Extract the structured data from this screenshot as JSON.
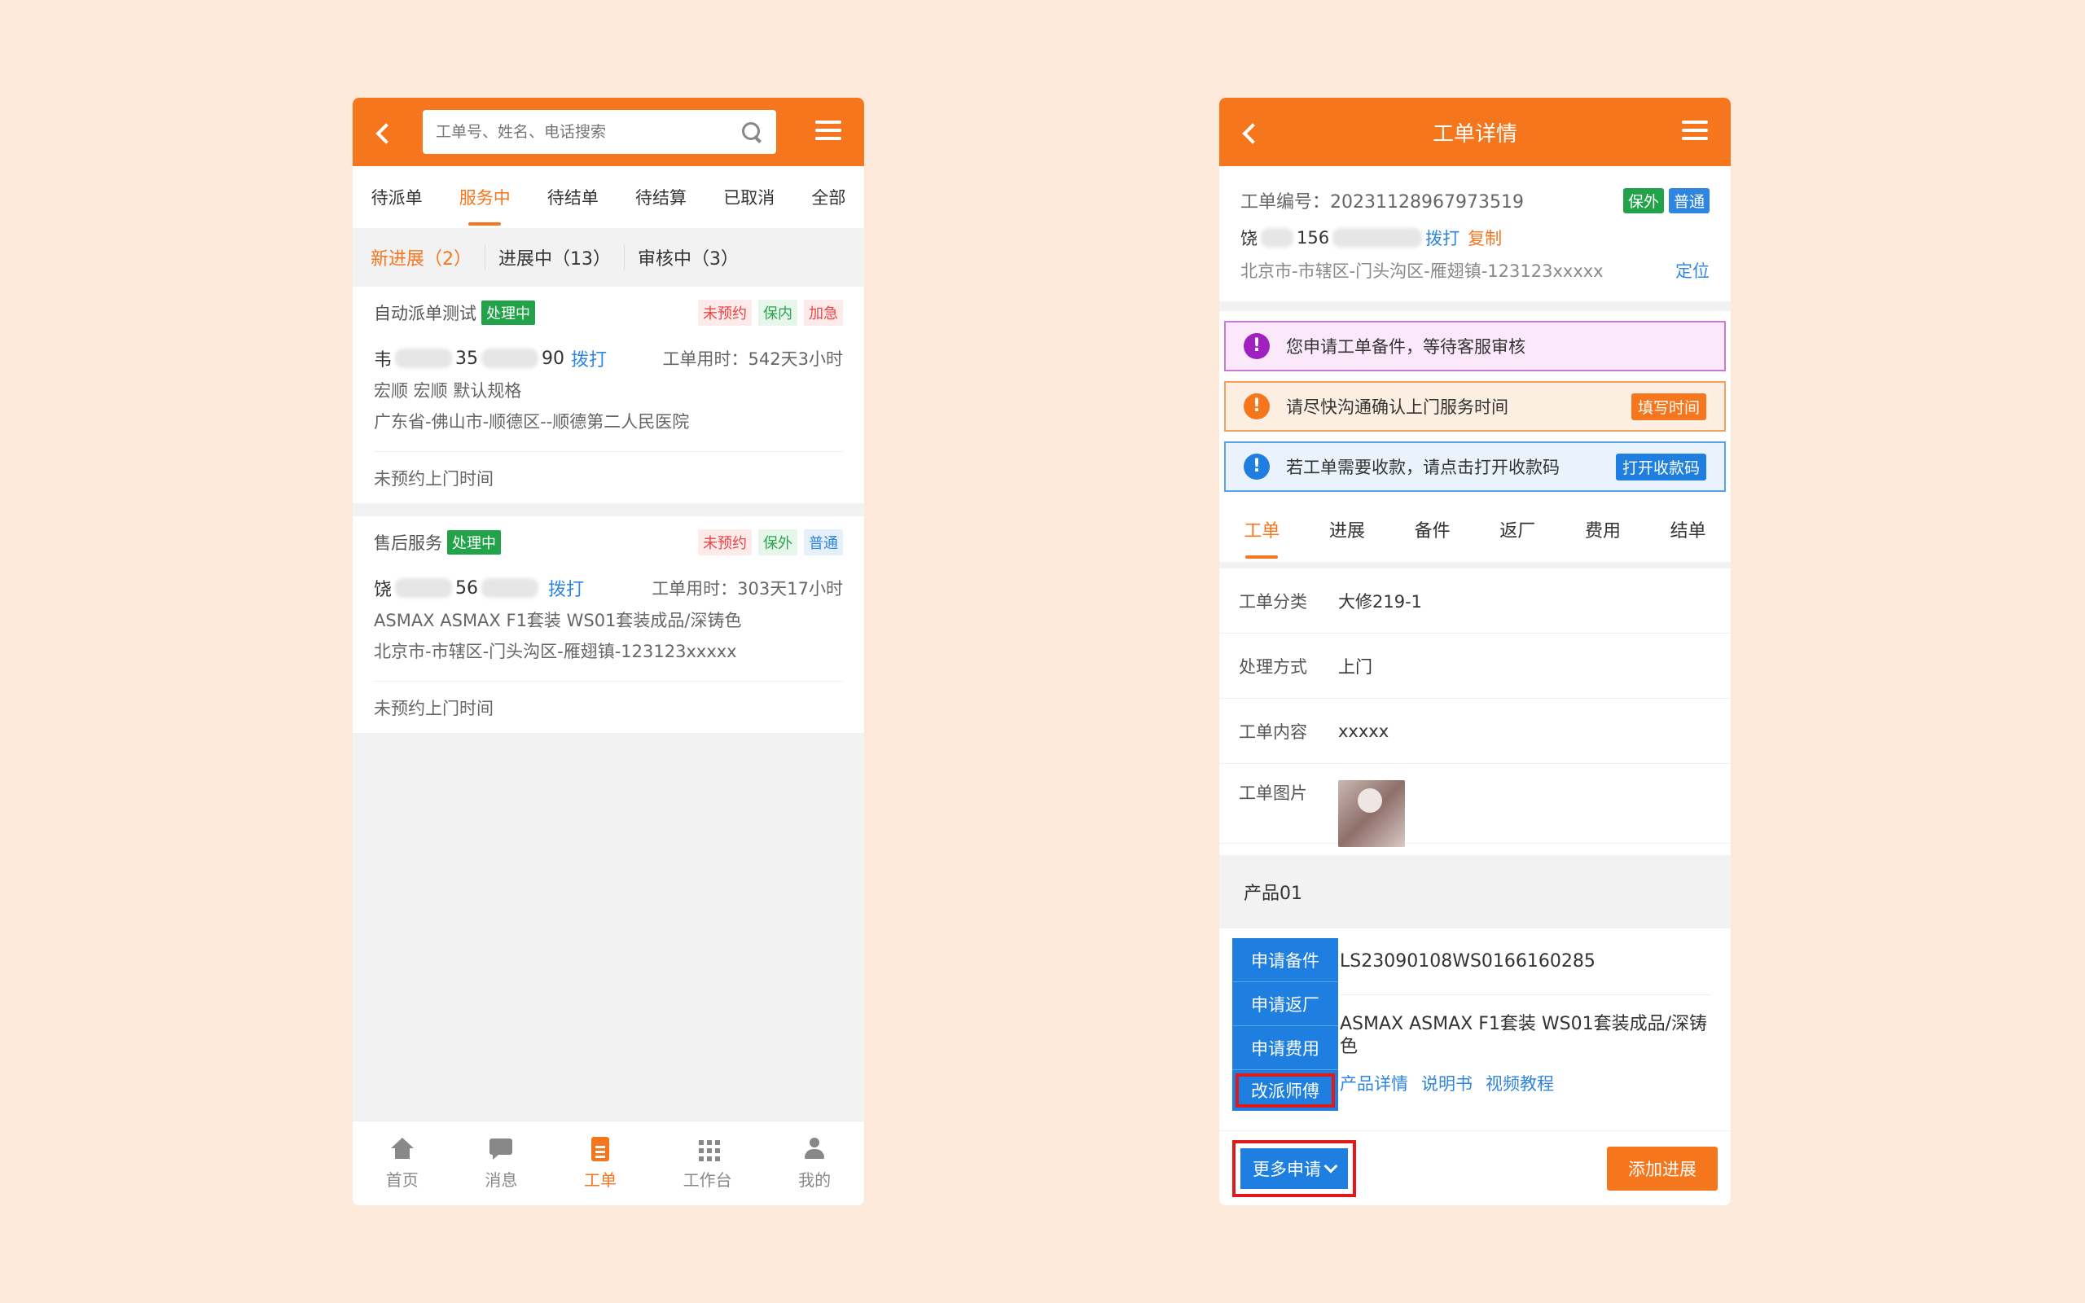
{
  "left": {
    "search": {
      "placeholder": "工单号、姓名、电话搜索"
    },
    "tabs": [
      "待派单",
      "服务中",
      "待结单",
      "待结算",
      "已取消",
      "全部"
    ],
    "subtabs": [
      "新进展（2）",
      "进展中（13）",
      "审核中（3）"
    ],
    "cards": [
      {
        "name": "自动派单测试",
        "status": "处理中",
        "tags": [
          "未预约",
          "保内",
          "加急"
        ],
        "contact_prefix": "韦",
        "contact_mid": "35",
        "contact_suffix": "90",
        "call": "拨打",
        "time_used": "工单用时：542天3小时",
        "product": "宏顺 宏顺 默认规格",
        "address": "广东省-佛山市-顺德区--顺德第二人民医院",
        "appointment": "未预约上门时间"
      },
      {
        "name": "售后服务",
        "status": "处理中",
        "tags": [
          "未预约",
          "保外",
          "普通"
        ],
        "contact_prefix": "饶",
        "contact_mid": "56",
        "contact_suffix": "",
        "call": "拨打",
        "time_used": "工单用时：303天17小时",
        "product": "ASMAX ASMAX F1套装 WS01套装成品/深铸色",
        "address": "北京市-市辖区-门头沟区-雁翅镇-123123xxxxx",
        "appointment": "未预约上门时间"
      }
    ],
    "nav": [
      "首页",
      "消息",
      "工单",
      "工作台",
      "我的"
    ]
  },
  "right": {
    "title": "工单详情",
    "order_no": "工单编号：20231128967973519",
    "badges": [
      "保外",
      "普通"
    ],
    "contact_prefix": "饶",
    "contact_mid": "156",
    "call": "拨打",
    "copy": "复制",
    "address": "北京市-市辖区-门头沟区-雁翅镇-123123xxxxx",
    "locate": "定位",
    "alerts": [
      {
        "text": "您申请工单备件，等待客服审核",
        "button": ""
      },
      {
        "text": "请尽快沟通确认上门服务时间",
        "button": "填写时间"
      },
      {
        "text": "若工单需要收款，请点击打开收款码",
        "button": "打开收款码"
      }
    ],
    "tabs": [
      "工单",
      "进展",
      "备件",
      "返厂",
      "费用",
      "结单"
    ],
    "fields": [
      {
        "label": "工单分类",
        "value": "大修219-1"
      },
      {
        "label": "处理方式",
        "value": "上门"
      },
      {
        "label": "工单内容",
        "value": "xxxxx"
      },
      {
        "label": "工单图片",
        "value": ""
      }
    ],
    "product_section": "产品01",
    "product_sn": "LS23090108WS0166160285",
    "product_name": "ASMAX ASMAX F1套装 WS01套装成品/深铸色",
    "product_links": [
      "产品详情",
      "说明书",
      "视频教程"
    ],
    "popup": [
      "申请备件",
      "申请返厂",
      "申请费用",
      "改派师傅"
    ],
    "more_button": "更多申请",
    "add_button": "添加进展"
  },
  "colors": {
    "accent": "#f6761e",
    "blue": "#1f7fe0",
    "green": "#22a34a",
    "highlight": "#e01a1a"
  }
}
